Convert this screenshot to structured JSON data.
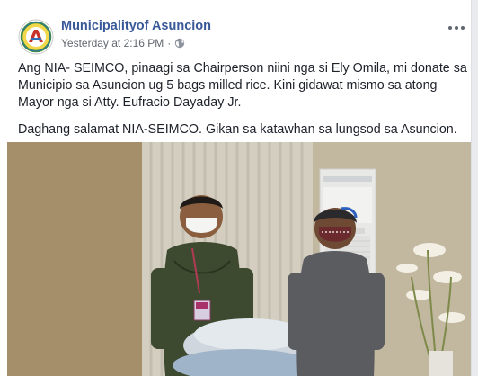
{
  "post": {
    "page_name": "Municipalityof Asuncion",
    "timestamp": "Yesterday at 2:16 PM",
    "separator": "·",
    "privacy_icon": "globe-icon",
    "more_icon": "more-options-icon",
    "paragraphs": [
      "Ang NIA- SEIMCO, pinaagi sa Chairperson niini nga si Ely Omila, mi donate sa Municipio sa Asuncion ug 5 bags milled rice. Kini gidawat mismo sa atong Mayor nga si Atty. Eufracio Dayaday Jr.",
      "Daghang salamat NIA-SEIMCO. Gikan sa katawhan sa lungsod sa Asuncion."
    ],
    "photo": {
      "description_icon": "donation-photo"
    }
  },
  "colors": {
    "link": "#385898",
    "text": "#1d2129",
    "meta": "#616770",
    "background": "#e9ebee"
  }
}
